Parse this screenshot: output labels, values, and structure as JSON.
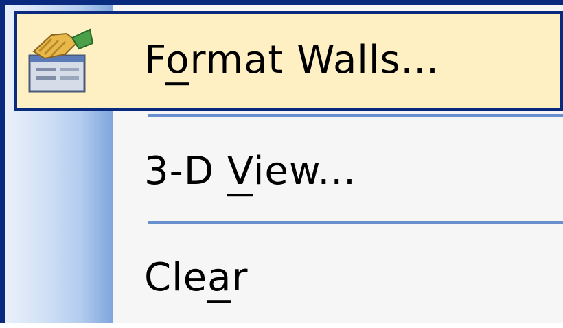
{
  "menu": {
    "items": [
      {
        "label_before": "F",
        "mnemonic": "o",
        "label_after": "rmat Walls...",
        "icon": "format-walls-icon",
        "highlighted": true
      },
      {
        "label_before": "3-D ",
        "mnemonic": "V",
        "label_after": "iew...",
        "icon": "",
        "highlighted": false
      },
      {
        "label_before": "Cle",
        "mnemonic": "a",
        "label_after": "r",
        "icon": "",
        "highlighted": false
      }
    ]
  },
  "colors": {
    "border": "#0a2a80",
    "highlight_bg": "#fef0c2",
    "separator": "#6a8fcf",
    "menu_bg": "#f6f6f6"
  }
}
